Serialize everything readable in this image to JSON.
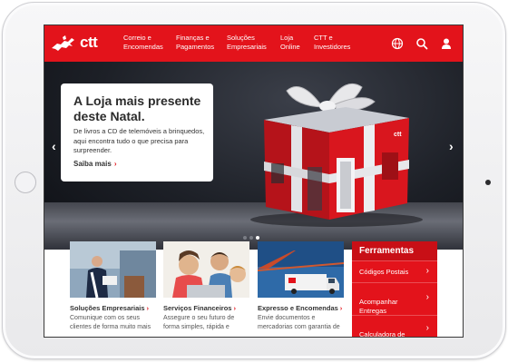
{
  "header": {
    "logo_text": "ctt",
    "nav": [
      {
        "label": "Correio e\nEncomendas"
      },
      {
        "label": "Finanças e\nPagamentos"
      },
      {
        "label": "Soluções\nEmpresariais"
      },
      {
        "label": "Loja\nOnline"
      },
      {
        "label": "CTT e\nInvestidores"
      }
    ],
    "icons": [
      "globe-icon",
      "search-icon",
      "user-icon"
    ]
  },
  "hero": {
    "title": "A Loja mais presente deste Natal.",
    "text": "De livros a CD de telemóveis a brinquedos, aqui encontra tudo o que precisa para surpreender.",
    "link": "Saiba mais",
    "box_logo": "ctt",
    "slides": 3,
    "active_slide": 3
  },
  "tiles": [
    {
      "title": "Soluções Empresariais",
      "text": "Comunique com os seus clientes de forma muito mais"
    },
    {
      "title": "Serviços Financeiros",
      "text": "Assegure o seu futuro de forma simples, rápida e"
    },
    {
      "title": "Expresso e Encomendas",
      "text": "Envie documentos e mercadorias com garantia de"
    }
  ],
  "tools": {
    "title": "Ferramentas",
    "items": [
      {
        "label": "Códigos Postais"
      },
      {
        "label": "Acompanhar\nEntregas"
      },
      {
        "label": "Calculadora de\nPreços"
      }
    ]
  },
  "colors": {
    "brand_red": "#e3131b",
    "dark_red": "#c80f16"
  }
}
